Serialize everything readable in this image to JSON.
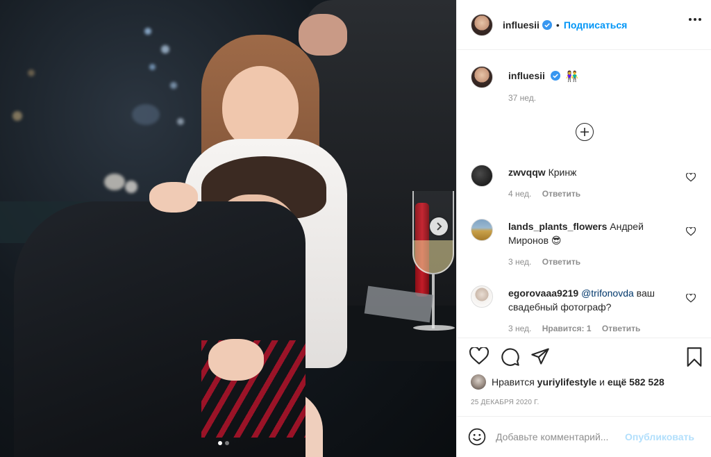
{
  "post": {
    "author": "influesii",
    "follow_label": "Подписаться",
    "separator": "•"
  },
  "caption": {
    "username": "influesii",
    "emoji": "👫",
    "time": "37 нед."
  },
  "comments": [
    {
      "username": "zwvqqw",
      "text": "Кринж",
      "time": "4 нед.",
      "reply_label": "Ответить"
    },
    {
      "username": "lands_plants_flowers",
      "text": "Андрей Миронов 😎",
      "time": "3 нед.",
      "reply_label": "Ответить"
    },
    {
      "username": "egorovaaa9219",
      "mention": "@trifonovda",
      "text": "ваш свадебный фотограф?",
      "time": "3 нед.",
      "likes_label": "Нравится: 1",
      "reply_label": "Ответить"
    }
  ],
  "likes": {
    "prefix": "Нравится",
    "user": "yuriylifestyle",
    "conj": "и",
    "others": "ещё 582 528"
  },
  "date": "25 ДЕКАБРЯ 2020 Г.",
  "add_comment": {
    "placeholder": "Добавьте комментарий...",
    "post_label": "Опубликовать"
  },
  "colors": {
    "accent": "#0095f6",
    "verified": "#3897f0",
    "muted": "#8e8e8e",
    "post_disabled": "#b2dffc"
  },
  "icons": [
    "heart-icon",
    "comment-icon",
    "share-icon",
    "bookmark-icon",
    "emoji-icon",
    "more-icon",
    "plus-circle-icon",
    "chevron-right-icon",
    "verified-badge-icon"
  ]
}
